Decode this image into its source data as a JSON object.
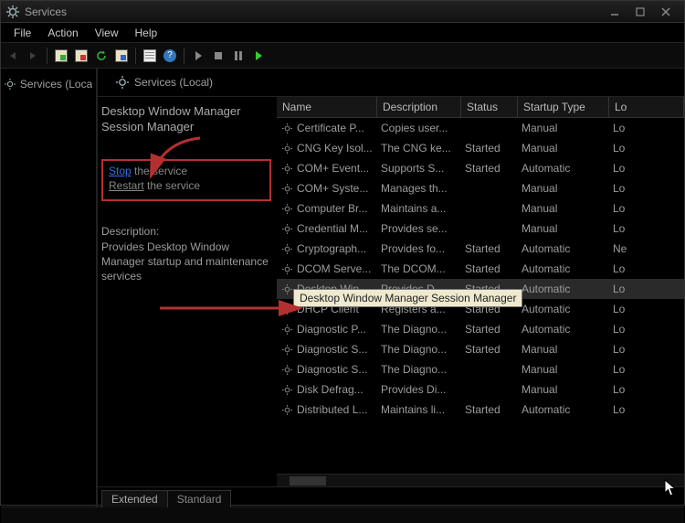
{
  "window": {
    "title": "Services"
  },
  "menu": {
    "file": "File",
    "action": "Action",
    "view": "View",
    "help": "Help"
  },
  "tree": {
    "root": "Services (Local)"
  },
  "pane": {
    "heading": "Services (Local)",
    "selected_name": "Desktop Window Manager Session Manager",
    "stop_link": "Stop",
    "stop_rest": " the service",
    "restart_link": "Restart",
    "restart_rest": " the service",
    "desc_label": "Description:",
    "desc_text": "Provides Desktop Window Manager startup and maintenance services"
  },
  "columns": {
    "name": "Name",
    "desc": "Description",
    "status": "Status",
    "startup": "Startup Type",
    "logon": "Log On As"
  },
  "rows": [
    {
      "name": "Certificate P...",
      "desc": "Copies user...",
      "status": "",
      "startup": "Manual",
      "logon": "Local System"
    },
    {
      "name": "CNG Key Isol...",
      "desc": "The CNG ke...",
      "status": "Started",
      "startup": "Manual",
      "logon": "Local System"
    },
    {
      "name": "COM+ Event...",
      "desc": "Supports S...",
      "status": "Started",
      "startup": "Automatic",
      "logon": "Local Service"
    },
    {
      "name": "COM+ Syste...",
      "desc": "Manages th...",
      "status": "",
      "startup": "Manual",
      "logon": "Local System"
    },
    {
      "name": "Computer Br...",
      "desc": "Maintains a...",
      "status": "",
      "startup": "Manual",
      "logon": "Local System"
    },
    {
      "name": "Credential M...",
      "desc": "Provides se...",
      "status": "",
      "startup": "Manual",
      "logon": "Local System"
    },
    {
      "name": "Cryptograph...",
      "desc": "Provides fo...",
      "status": "Started",
      "startup": "Automatic",
      "logon": "Network Service"
    },
    {
      "name": "DCOM Serve...",
      "desc": "The DCOM...",
      "status": "Started",
      "startup": "Automatic",
      "logon": "Local System"
    },
    {
      "name": "Desktop Win...",
      "desc": "Provides D...",
      "status": "Started",
      "startup": "Automatic",
      "logon": "Local System",
      "selected": true
    },
    {
      "name": "DHCP Client",
      "desc": "Registers a...",
      "status": "Started",
      "startup": "Automatic",
      "logon": "Local Service"
    },
    {
      "name": "Diagnostic P...",
      "desc": "The Diagno...",
      "status": "Started",
      "startup": "Automatic",
      "logon": "Local Service"
    },
    {
      "name": "Diagnostic S...",
      "desc": "The Diagno...",
      "status": "Started",
      "startup": "Manual",
      "logon": "Local Service"
    },
    {
      "name": "Diagnostic S...",
      "desc": "The Diagno...",
      "status": "",
      "startup": "Manual",
      "logon": "Local System"
    },
    {
      "name": "Disk Defrag...",
      "desc": "Provides Di...",
      "status": "",
      "startup": "Manual",
      "logon": "Local System"
    },
    {
      "name": "Distributed L...",
      "desc": "Maintains li...",
      "status": "Started",
      "startup": "Automatic",
      "logon": "Local System"
    }
  ],
  "tooltip": "Desktop Window Manager Session Manager",
  "tabs": {
    "extended": "Extended",
    "standard": "Standard"
  }
}
